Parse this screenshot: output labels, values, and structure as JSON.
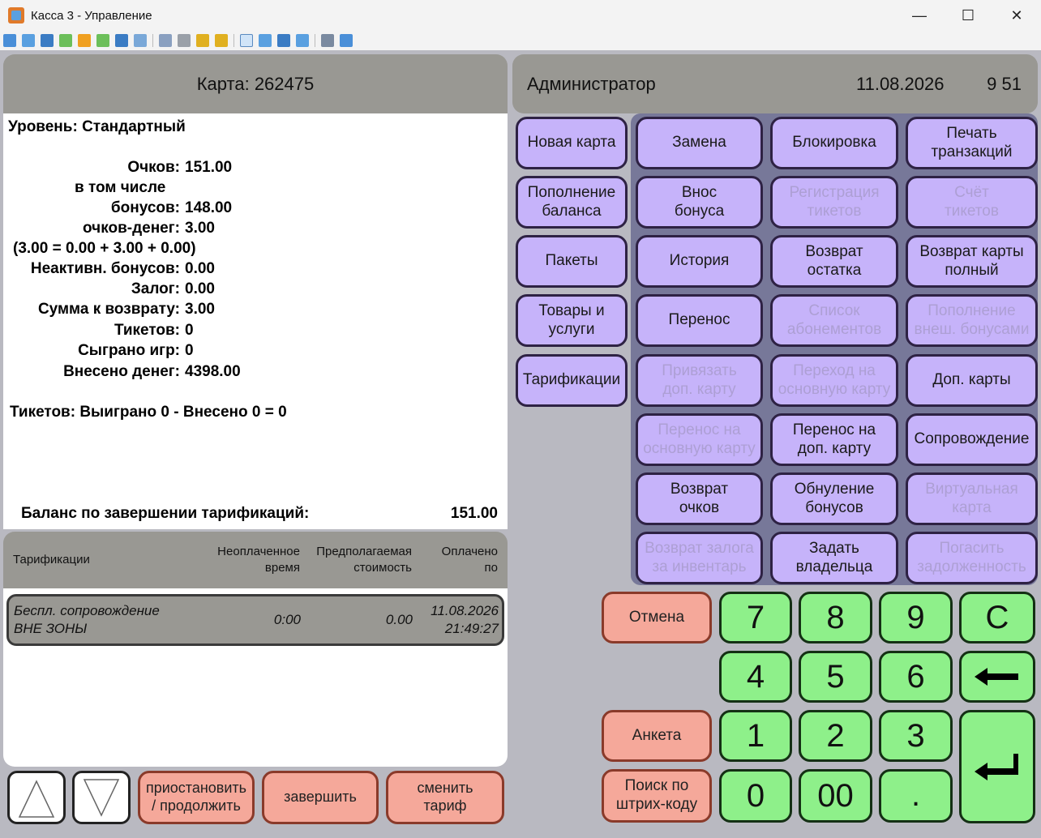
{
  "window": {
    "title": "Касса 3 - Управление"
  },
  "card": {
    "header": "Карта: 262475"
  },
  "user": {
    "role": "Администратор",
    "date": "11.08.2026",
    "time": "9 51"
  },
  "info": {
    "level": "Уровень: Стандартный",
    "points_label": "Очков:",
    "points_value": "151.00",
    "including": "в том числе",
    "bonuses_label": "бонусов:",
    "bonuses_value": "148.00",
    "money_points_label": "очков-денег:",
    "money_points_value": "3.00",
    "formula": "(3.00 = 0.00 + 3.00 + 0.00)",
    "inactive_label": "Неактивн. бонусов:",
    "inactive_value": "0.00",
    "deposit_label": "Залог:",
    "deposit_value": "0.00",
    "refund_label": "Сумма к возврату:",
    "refund_value": "3.00",
    "tickets_label": "Тикетов:",
    "tickets_value": "0",
    "games_label": "Сыграно игр:",
    "games_value": "0",
    "money_in_label": "Внесено денег:",
    "money_in_value": "4398.00",
    "tickets_summary": "Тикетов: Выиграно 0 - Внесено 0 = 0",
    "balance_label": "Баланс по завершении тарификаций:",
    "balance_value": "151.00"
  },
  "table": {
    "headers": {
      "name": "Тарификации",
      "unpaid1": "Неоплаченное",
      "unpaid2": "время",
      "cost1": "Предполагаемая",
      "cost2": "стоимость",
      "paid1": "Оплачено",
      "paid2": "по"
    },
    "rows": [
      {
        "name1": "Беспл. сопровождение",
        "name2": "ВНЕ ЗОНЫ",
        "time": "0:00",
        "cost": "0.00",
        "paid_date": "11.08.2026",
        "paid_time": "21:49:27"
      }
    ]
  },
  "bottom": {
    "pause": "приостановить\n/ продолжить",
    "finish": "завершить",
    "change": "сменить\nтариф"
  },
  "left_buttons": [
    "Новая карта",
    "Пополнение\nбаланса",
    "Пакеты",
    "Товары и\nуслуги",
    "Тарификации"
  ],
  "grid": [
    [
      "Замена",
      "Блокировка",
      "Печать\nтранзакций"
    ],
    [
      "Внос\nбонуса",
      "Регистрация\nтикетов",
      "Счёт\nтикетов"
    ],
    [
      "История",
      "Возврат\nостатка",
      "Возврат карты\nполный"
    ],
    [
      "Перенос",
      "Список\nабонементов",
      "Пополнение\nвнеш. бонусами"
    ],
    [
      "Привязать\nдоп. карту",
      "Переход на\nосновную карту",
      "Доп. карты"
    ],
    [
      "Перенос на\nосновную карту",
      "Перенос на\nдоп. карту",
      "Сопровождение"
    ],
    [
      "Возврат\nочков",
      "Обнуление\nбонусов",
      "Виртуальная\nкарта"
    ],
    [
      "Возврат залога\nза инвентарь",
      "Задать\nвладельца",
      "Погасить\nзадолженность"
    ]
  ],
  "disabled": [
    [
      false,
      false,
      false
    ],
    [
      false,
      true,
      true
    ],
    [
      false,
      false,
      false
    ],
    [
      false,
      true,
      true
    ],
    [
      true,
      true,
      false
    ],
    [
      true,
      false,
      false
    ],
    [
      false,
      false,
      true
    ],
    [
      true,
      false,
      true
    ]
  ],
  "numpad": {
    "k7": "7",
    "k8": "8",
    "k9": "9",
    "kc": "C",
    "k4": "4",
    "k5": "5",
    "k6": "6",
    "k1": "1",
    "k2": "2",
    "k3": "3",
    "k0": "0",
    "k00": "00",
    "kdot": "."
  },
  "side": {
    "cancel": "Отмена",
    "form": "Анкета",
    "search": "Поиск по\nштрих-коду"
  },
  "colors": {
    "purple": "#c6b3fa",
    "green": "#8ef08a",
    "salmon": "#f5a89a",
    "gray": "#999893"
  }
}
